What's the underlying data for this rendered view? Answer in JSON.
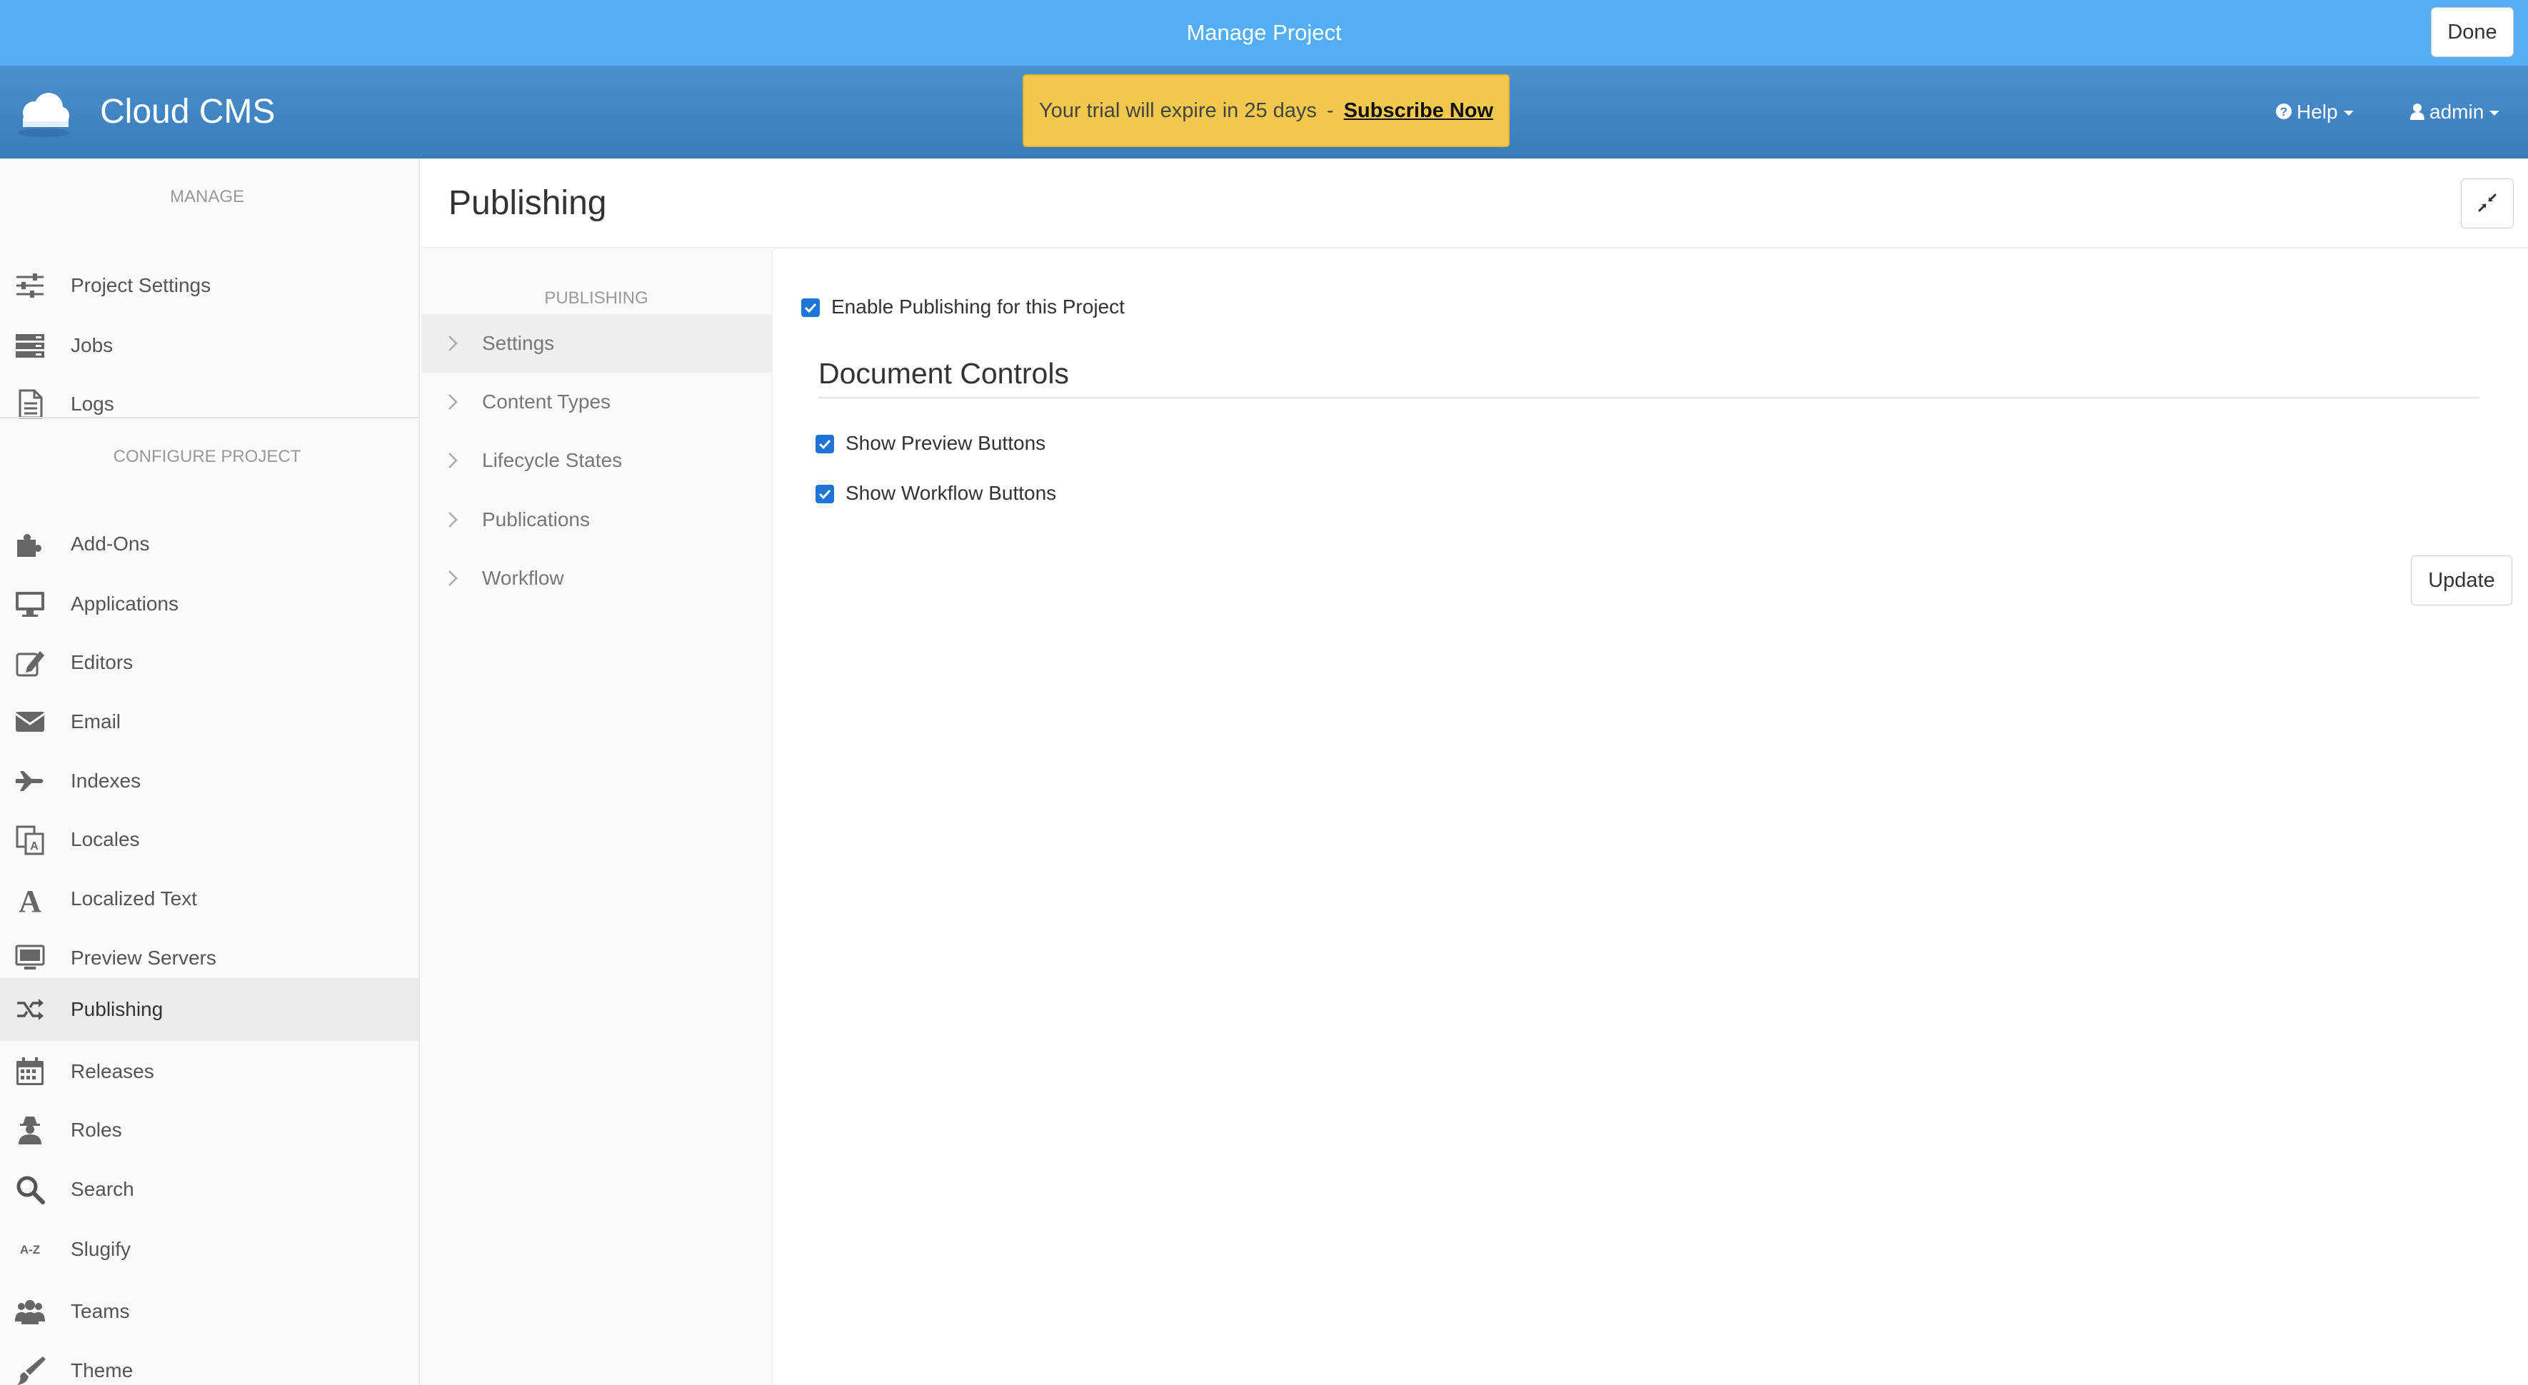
{
  "topbar": {
    "title": "Manage Project",
    "done_label": "Done"
  },
  "header": {
    "brand": "Cloud CMS",
    "trial_text": "Your trial will expire in 25 days",
    "trial_separator": "-",
    "trial_link": "Subscribe Now",
    "help_label": "Help",
    "admin_label": "admin"
  },
  "sidebar": {
    "manage_heading": "MANAGE",
    "manage_items": [
      {
        "label": "Project Settings",
        "icon": "sliders-icon"
      },
      {
        "label": "Jobs",
        "icon": "server-icon"
      },
      {
        "label": "Logs",
        "icon": "file-text-icon"
      }
    ],
    "configure_heading": "CONFIGURE PROJECT",
    "configure_items": [
      {
        "label": "Add-Ons",
        "icon": "puzzle-icon"
      },
      {
        "label": "Applications",
        "icon": "desktop-icon"
      },
      {
        "label": "Editors",
        "icon": "edit-icon"
      },
      {
        "label": "Email",
        "icon": "envelope-icon"
      },
      {
        "label": "Indexes",
        "icon": "plane-icon"
      },
      {
        "label": "Locales",
        "icon": "translate-icon"
      },
      {
        "label": "Localized Text",
        "icon": "font-icon"
      },
      {
        "label": "Preview Servers",
        "icon": "monitor-icon"
      },
      {
        "label": "Publishing",
        "icon": "shuffle-icon",
        "active": true
      },
      {
        "label": "Releases",
        "icon": "calendar-icon"
      },
      {
        "label": "Roles",
        "icon": "user-secret-icon"
      },
      {
        "label": "Search",
        "icon": "search-icon"
      },
      {
        "label": "Slugify",
        "icon": "sort-alpha-icon"
      },
      {
        "label": "Teams",
        "icon": "users-icon"
      },
      {
        "label": "Theme",
        "icon": "brush-icon"
      }
    ]
  },
  "main": {
    "title": "Publishing",
    "subnav": {
      "heading": "PUBLISHING",
      "items": [
        {
          "label": "Settings",
          "active": true
        },
        {
          "label": "Content Types"
        },
        {
          "label": "Lifecycle States"
        },
        {
          "label": "Publications"
        },
        {
          "label": "Workflow"
        }
      ]
    },
    "enable_label": "Enable Publishing for this Project",
    "enable_checked": true,
    "document_controls_title": "Document Controls",
    "show_preview_label": "Show Preview Buttons",
    "show_preview_checked": true,
    "show_workflow_label": "Show Workflow Buttons",
    "show_workflow_checked": true,
    "update_label": "Update"
  },
  "colors": {
    "topbar": "#54aef4",
    "header": "#3f84c4",
    "trial_banner": "#f2c94c",
    "checkbox": "#1f74d8"
  }
}
